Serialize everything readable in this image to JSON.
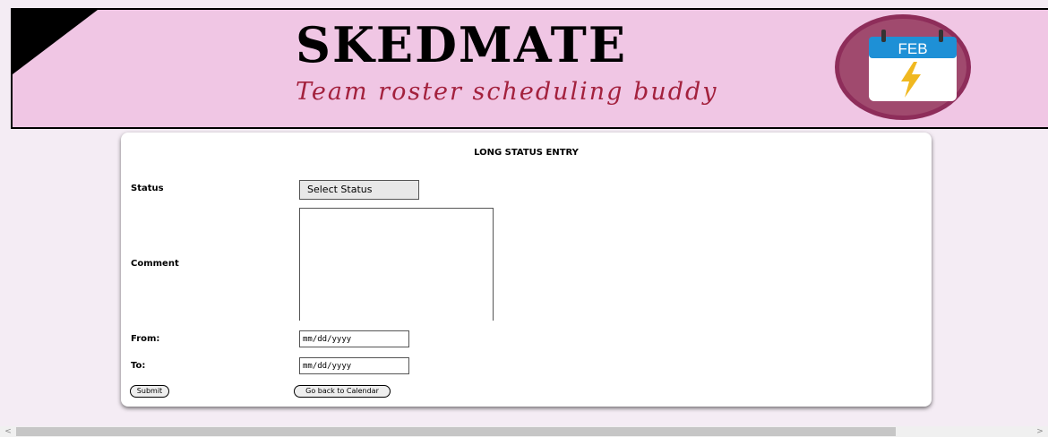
{
  "header": {
    "title": "SKEDMATE",
    "subtitle": "Team roster scheduling buddy",
    "logo": {
      "month": "FEB",
      "icon": "calendar-lightning-icon"
    }
  },
  "form": {
    "title": "LONG STATUS ENTRY",
    "status_label": "Status",
    "status_selected": "Select Status",
    "comment_label": "Comment",
    "from_label": "From:",
    "from_placeholder": "mm/dd/yyyy",
    "to_label": "To:",
    "to_placeholder": "mm/dd/yyyy",
    "submit_label": "Submit",
    "back_label": "Go back to Calendar"
  },
  "scrollbar": {
    "left_arrow": "<",
    "right_arrow": ">"
  },
  "colors": {
    "header_bg": "#f0c6e4",
    "subtitle": "#a3213d",
    "logo_ring": "#8e2d5a",
    "logo_fill": "#a04a6e",
    "calendar_bar": "#1e90d6",
    "bolt": "#f0b820"
  }
}
